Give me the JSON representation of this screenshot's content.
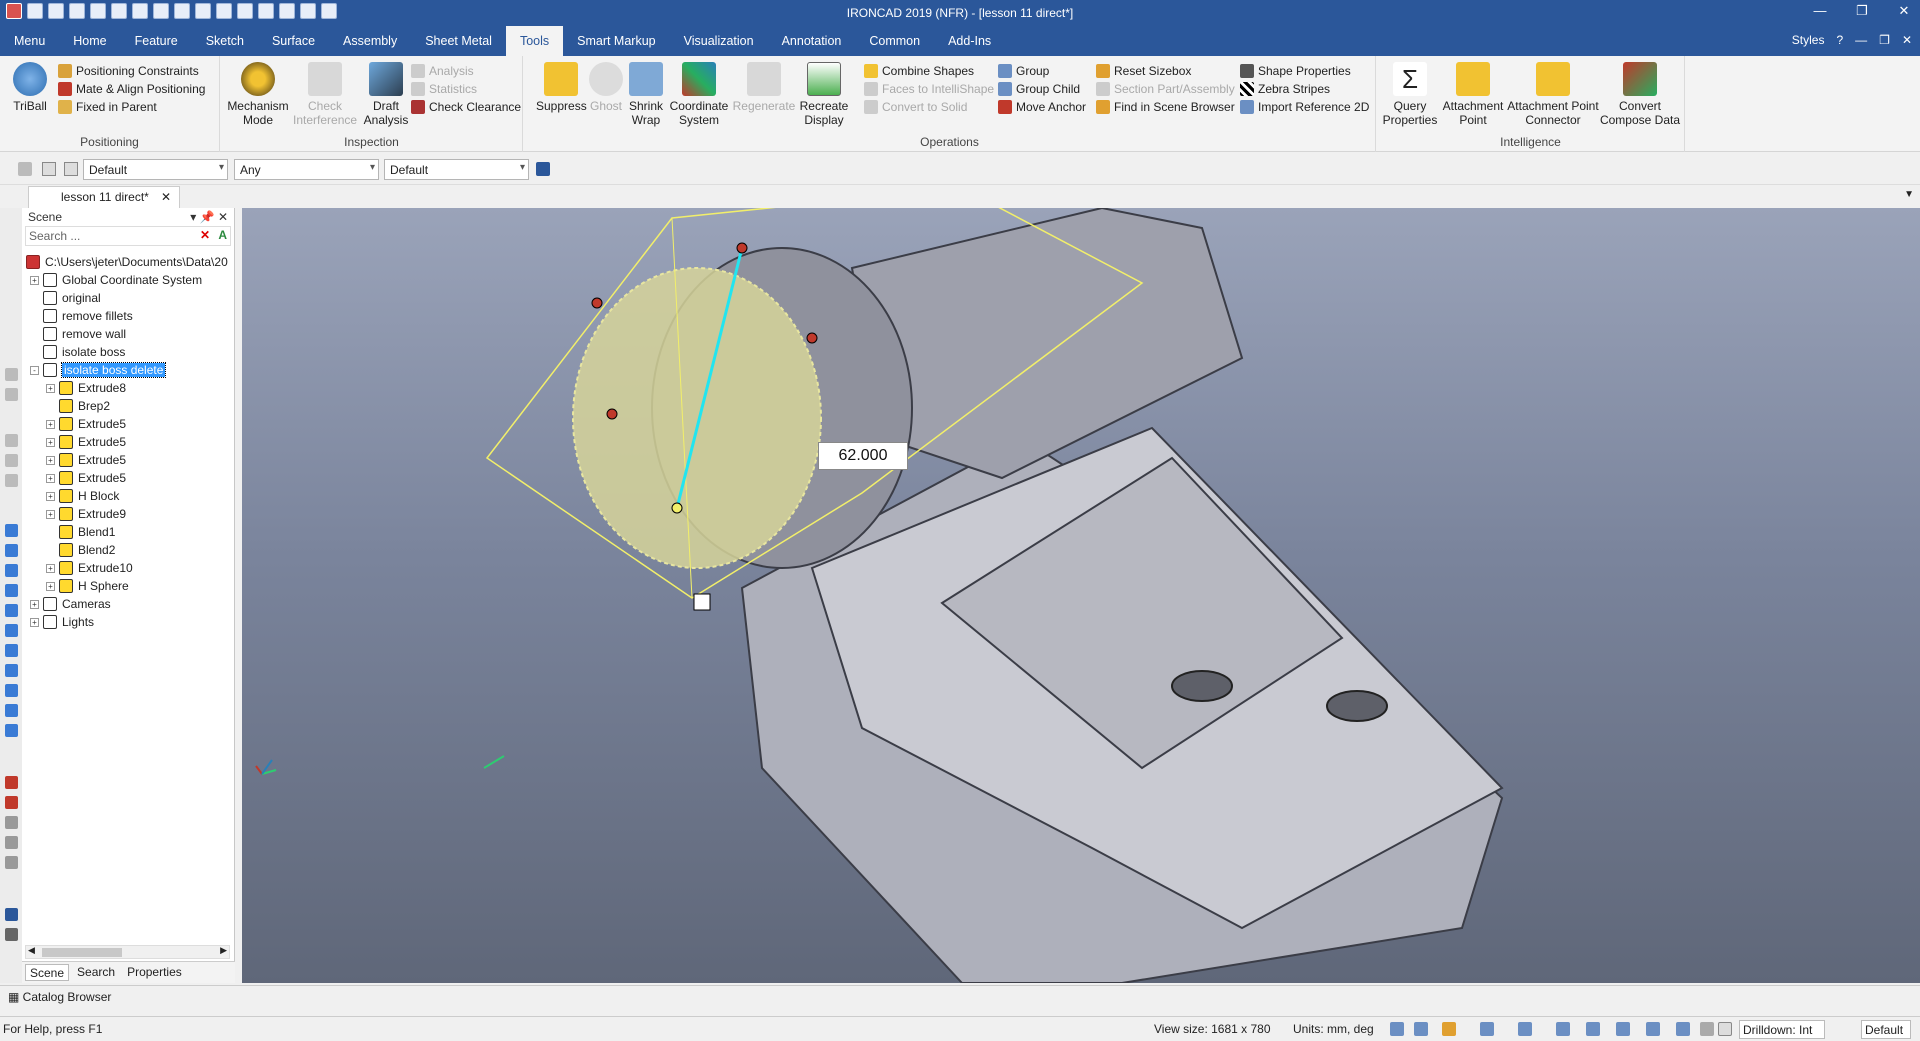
{
  "app": {
    "title": "IRONCAD 2019 (NFR) - [lesson 11 direct*]"
  },
  "tabs": [
    "Menu",
    "Home",
    "Feature",
    "Sketch",
    "Surface",
    "Assembly",
    "Sheet Metal",
    "Tools",
    "Smart Markup",
    "Visualization",
    "Annotation",
    "Common",
    "Add-Ins"
  ],
  "active_tab": "Tools",
  "styles_label": "Styles",
  "ribbon": {
    "positioning": {
      "label": "Positioning",
      "triball": "TriBall",
      "items": [
        "Positioning Constraints",
        "Mate & Align Positioning",
        "Fixed in Parent"
      ]
    },
    "inspection": {
      "label": "Inspection",
      "mechanism": "Mechanism Mode",
      "check_interference": "Check Interference",
      "draft_analysis": "Draft Analysis",
      "items": [
        "Analysis",
        "Statistics",
        "Check Clearance"
      ]
    },
    "operations": {
      "label": "Operations",
      "suppress": "Suppress",
      "ghost": "Ghost",
      "shrink_wrap": "Shrink Wrap",
      "coordinate_system": "Coordinate System",
      "regenerate": "Regenerate",
      "recreate_display": "Recreate Display",
      "col1": [
        "Combine Shapes",
        "Faces to IntelliShape",
        "Convert to Solid"
      ],
      "col2": [
        "Group",
        "Group Child",
        "Move Anchor"
      ],
      "col3": [
        "Reset Sizebox",
        "Section Part/Assembly",
        "Find in Scene Browser"
      ],
      "col4": [
        "Shape Properties",
        "Zebra Stripes",
        "Import Reference 2D"
      ]
    },
    "intelligence": {
      "label": "Intelligence",
      "query_properties": "Query Properties",
      "attachment_point": "Attachment Point",
      "attachment_point_connector": "Attachment Point Connector",
      "convert_compose_data": "Convert Compose Data"
    }
  },
  "filters": {
    "combo1": "Default",
    "combo2": "Any",
    "combo3": "Default"
  },
  "document_tab": "lesson 11 direct*",
  "scene": {
    "header": "Scene",
    "search_placeholder": "Search ...",
    "path": "C:\\Users\\jeter\\Documents\\Data\\20",
    "tree": [
      {
        "label": "Global Coordinate System",
        "level": 1,
        "expander": "+"
      },
      {
        "label": "original",
        "level": 1,
        "expander": ""
      },
      {
        "label": "remove fillets",
        "level": 1,
        "expander": ""
      },
      {
        "label": "remove wall",
        "level": 1,
        "expander": ""
      },
      {
        "label": "isolate boss",
        "level": 1,
        "expander": ""
      },
      {
        "label": "isolate boss delete",
        "level": 1,
        "expander": "-",
        "selected": true
      },
      {
        "label": "Extrude8",
        "level": 2,
        "expander": "+"
      },
      {
        "label": "Brep2",
        "level": 2,
        "expander": ""
      },
      {
        "label": "Extrude5",
        "level": 2,
        "expander": "+"
      },
      {
        "label": "Extrude5",
        "level": 2,
        "expander": "+"
      },
      {
        "label": "Extrude5",
        "level": 2,
        "expander": "+"
      },
      {
        "label": "Extrude5",
        "level": 2,
        "expander": "+"
      },
      {
        "label": "H Block",
        "level": 2,
        "expander": "+"
      },
      {
        "label": "Extrude9",
        "level": 2,
        "expander": "+"
      },
      {
        "label": "Blend1",
        "level": 2,
        "expander": ""
      },
      {
        "label": "Blend2",
        "level": 2,
        "expander": ""
      },
      {
        "label": "Extrude10",
        "level": 2,
        "expander": "+"
      },
      {
        "label": "H Sphere",
        "level": 2,
        "expander": "+"
      },
      {
        "label": "Cameras",
        "level": 1,
        "expander": "+"
      },
      {
        "label": "Lights",
        "level": 1,
        "expander": "+"
      }
    ],
    "bottom_tabs": [
      "Scene",
      "Search",
      "Properties"
    ]
  },
  "viewport": {
    "dimension": "62.000"
  },
  "catalog": "Catalog Browser",
  "status": {
    "help": "For Help, press F1",
    "view_size": "View size: 1681 x 780",
    "units": "Units: mm, deg",
    "drilldown": "Drilldown: Int",
    "default": "Default"
  }
}
